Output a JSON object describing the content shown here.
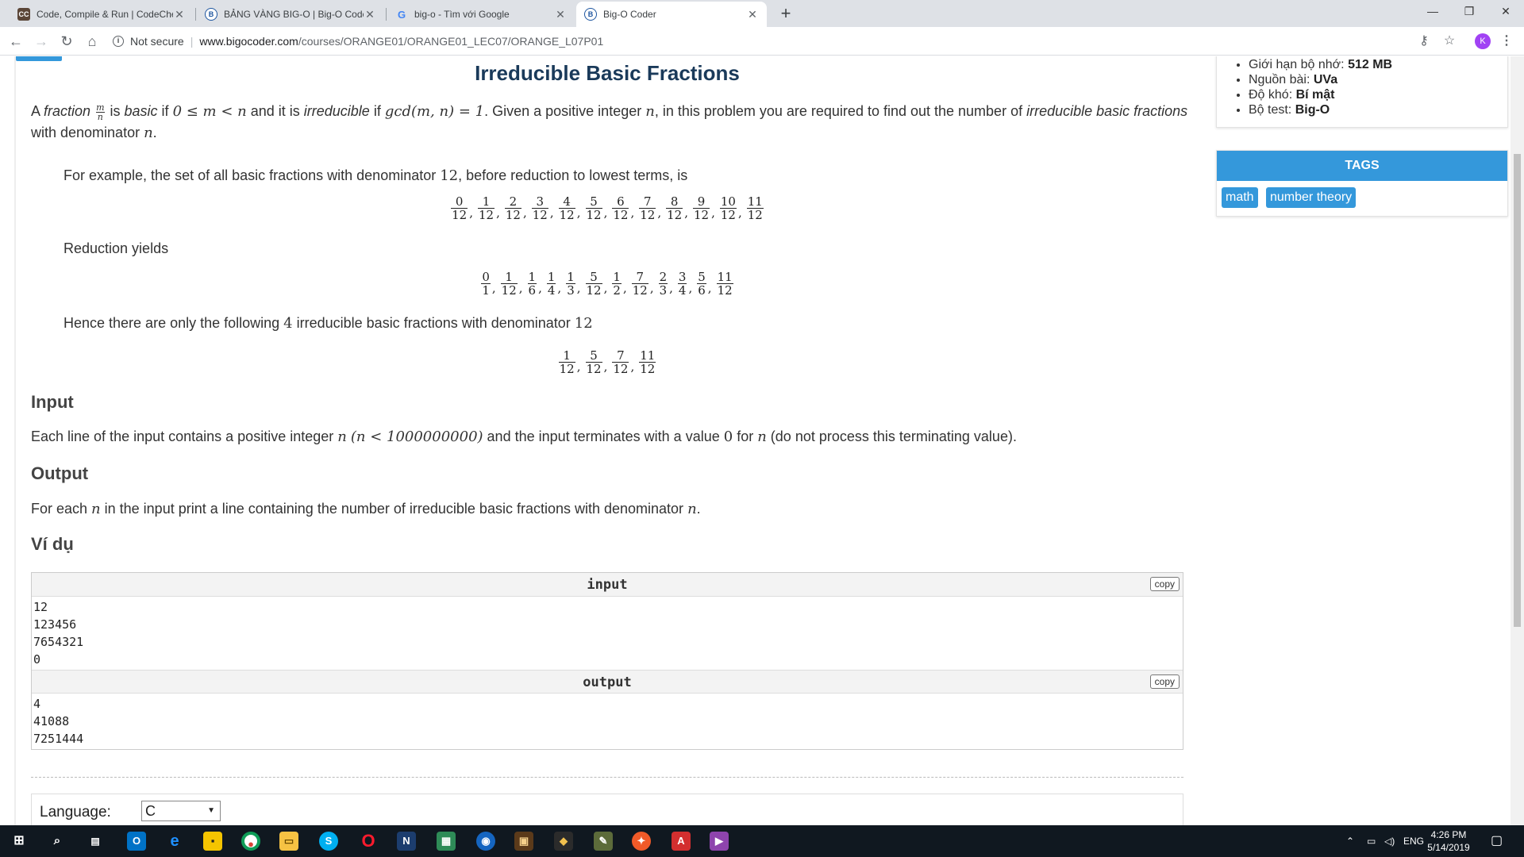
{
  "browser": {
    "tabs": [
      {
        "title": "Code, Compile & Run | CodeChef",
        "favicon_text": "CC",
        "favicon_color": "#5b4638",
        "active": false
      },
      {
        "title": "BẢNG VÀNG BIG-O | Big-O Coder",
        "favicon_text": "B",
        "favicon_color": "#1e56a0",
        "active": false
      },
      {
        "title": "big-o - Tìm với Google",
        "favicon_text": "G",
        "favicon_color": "#4285f4",
        "active": false
      },
      {
        "title": "Big-O Coder",
        "favicon_text": "B",
        "favicon_color": "#1e56a0",
        "active": true
      }
    ],
    "address": {
      "security": "Not secure",
      "host": "www.bigocoder.com",
      "path": "/courses/ORANGE01/ORANGE01_LEC07/ORANGE_L07P01"
    },
    "profile_initial": "K"
  },
  "problem": {
    "title": "Irreducible Basic Fractions",
    "intro": {
      "p1_a": "A ",
      "p1_fraction": "fraction",
      "p1_b": " is ",
      "p1_basic": "basic",
      "p1_c": " if ",
      "p1_cond1": "0 ≤ m < n",
      "p1_d": " and it is ",
      "p1_irred": "irreducible",
      "p1_e": " if ",
      "p1_cond2": "gcd(m, n) = 1",
      "p1_f": ". Given a positive integer ",
      "p1_n": "n",
      "p1_g": ", in this problem you are required to find out the number of ",
      "p1_ibf": "irreducible basic fractions",
      "p1_line2": "with denominator ",
      "p1_n2": "n",
      "p1_end": ".",
      "frac_num": "m",
      "frac_den": "n"
    },
    "example_text_a": "For example, the set of all basic fractions with denominator ",
    "example_num": "12",
    "example_text_b": ", before reduction to lowest terms, is",
    "set_all": [
      [
        "0",
        "12"
      ],
      [
        "1",
        "12"
      ],
      [
        "2",
        "12"
      ],
      [
        "3",
        "12"
      ],
      [
        "4",
        "12"
      ],
      [
        "5",
        "12"
      ],
      [
        "6",
        "12"
      ],
      [
        "7",
        "12"
      ],
      [
        "8",
        "12"
      ],
      [
        "9",
        "12"
      ],
      [
        "10",
        "12"
      ],
      [
        "11",
        "12"
      ]
    ],
    "reduction_text": "Reduction yields",
    "set_reduced": [
      [
        "0",
        "1"
      ],
      [
        "1",
        "12"
      ],
      [
        "1",
        "6"
      ],
      [
        "1",
        "4"
      ],
      [
        "1",
        "3"
      ],
      [
        "5",
        "12"
      ],
      [
        "1",
        "2"
      ],
      [
        "7",
        "12"
      ],
      [
        "2",
        "3"
      ],
      [
        "3",
        "4"
      ],
      [
        "5",
        "6"
      ],
      [
        "11",
        "12"
      ]
    ],
    "hence_a": "Hence there are only the following ",
    "hence_count": "4",
    "hence_b": " irreducible basic fractions with denominator ",
    "hence_den": "12",
    "set_irreducible": [
      [
        "1",
        "12"
      ],
      [
        "5",
        "12"
      ],
      [
        "7",
        "12"
      ],
      [
        "11",
        "12"
      ]
    ],
    "input_heading": "Input",
    "input_text_a": "Each line of the input contains a positive integer ",
    "input_n": "n",
    "input_cond": "(n < 1000000000)",
    "input_text_b": " and the input terminates with a value ",
    "input_zero": "0",
    "input_text_c": " for ",
    "input_n2": "n",
    "input_text_d": " (do not process this terminating value).",
    "output_heading": "Output",
    "output_text_a": "For each ",
    "output_n": "n",
    "output_text_b": " in the input print a line containing the number of irreducible basic fractions with denominator ",
    "output_n2": "n",
    "output_end": ".",
    "example_heading": "Ví dụ",
    "sample": {
      "input_label": "input",
      "input_lines": [
        "12",
        "123456",
        "7654321",
        "0"
      ],
      "output_label": "output",
      "output_lines": [
        "4",
        "41088",
        "7251444"
      ],
      "copy_label": "copy"
    }
  },
  "editor": {
    "language_label": "Language:",
    "language_value": "C"
  },
  "sidebar": {
    "info": [
      {
        "label": "Giới hạn bộ nhớ: ",
        "value": "512 MB"
      },
      {
        "label": "Nguồn bài: ",
        "value": "UVa"
      },
      {
        "label": "Độ khó: ",
        "value": "Bí mật"
      },
      {
        "label": "Bộ test: ",
        "value": "Big-O"
      }
    ],
    "tags_title": "TAGS",
    "tags": [
      "math",
      "number theory"
    ]
  },
  "taskbar": {
    "lang": "ENG",
    "time": "4:26 PM",
    "date": "5/14/2019"
  },
  "colors": {
    "accent": "#3498db",
    "title": "#1a3a5a"
  }
}
